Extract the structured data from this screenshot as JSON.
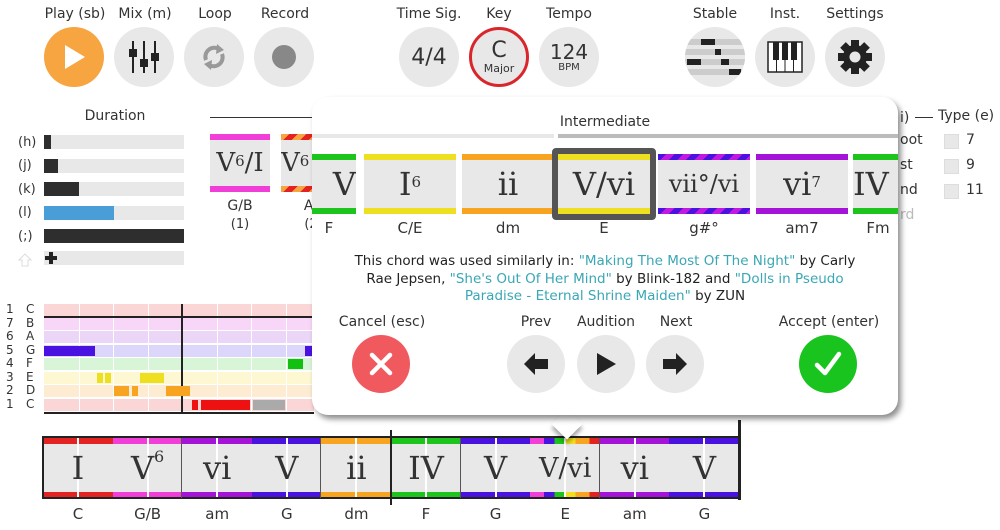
{
  "toolbar": {
    "play": {
      "label": "Play (sb)",
      "icon": "play-icon"
    },
    "mix": {
      "label": "Mix (m)",
      "icon": "mixer-sliders-icon"
    },
    "loop": {
      "label": "Loop",
      "icon": "loop-arrows-icon"
    },
    "record": {
      "label": "Record",
      "icon": "record-dot-icon"
    },
    "time_sig": {
      "label": "Time Sig.",
      "value": "4/4"
    },
    "key": {
      "label": "Key",
      "value": "C",
      "mode": "Major"
    },
    "tempo": {
      "label": "Tempo",
      "value": "124",
      "unit": "BPM"
    },
    "stable": {
      "label": "Stable",
      "icon": "piano-roll-icon"
    },
    "inst": {
      "label": "Inst.",
      "icon": "piano-keys-icon"
    },
    "settings": {
      "label": "Settings",
      "icon": "gear-icon"
    },
    "accent_color": "#f7a541",
    "key_ring_color": "#d9262b"
  },
  "duration": {
    "title": "Duration",
    "rows": [
      {
        "key": "(h)",
        "fill": 0.05,
        "selected": false
      },
      {
        "key": "(j)",
        "fill": 0.1,
        "selected": false
      },
      {
        "key": "(k)",
        "fill": 0.25,
        "selected": false
      },
      {
        "key": "(l)",
        "fill": 0.5,
        "selected": true
      },
      {
        "key": "(;)",
        "fill": 1.0,
        "selected": false
      }
    ],
    "add_row_icon": "plus-icon",
    "shift_icon": "shift-arrow-icon",
    "selected_color": "#4a9ed8"
  },
  "background_suggestions": [
    {
      "numeral": "V",
      "sup": "6",
      "suffix": "/I",
      "name": "G/B",
      "hotkey": "(1)"
    },
    {
      "numeral": "V",
      "sup": "6",
      "suffix": "",
      "name": "A/",
      "hotkey": "(2"
    }
  ],
  "type_panel": {
    "title": "Type (e)",
    "partial_left_label": "i)",
    "options": [
      "7",
      "9",
      "11"
    ],
    "partial_inversion_labels": [
      "oot",
      "st",
      "nd",
      "rd"
    ]
  },
  "piano_roll": {
    "rows": [
      {
        "degree": "1",
        "note": "C"
      },
      {
        "degree": "7",
        "note": "B"
      },
      {
        "degree": "6",
        "note": "A"
      },
      {
        "degree": "5",
        "note": "G"
      },
      {
        "degree": "4",
        "note": "F"
      },
      {
        "degree": "3",
        "note": "E"
      },
      {
        "degree": "2",
        "note": "D"
      },
      {
        "degree": "1",
        "note": "C"
      }
    ]
  },
  "popup": {
    "section_title": "Intermediate",
    "chords": [
      {
        "numeral": "V",
        "sup": "",
        "name": "F",
        "partial": true
      },
      {
        "numeral": "I",
        "sup": "6",
        "name": "C/E"
      },
      {
        "numeral": "ii",
        "sup": "",
        "name": "dm"
      },
      {
        "numeral": "V/vi",
        "sup": "",
        "name": "E",
        "selected": true
      },
      {
        "numeral": "vii°/vi",
        "sup": "",
        "name": "g#°"
      },
      {
        "numeral": "vi",
        "sup": "7",
        "name": "am7"
      },
      {
        "numeral": "IV",
        "sup": "",
        "name": "Fm",
        "partial": true
      }
    ],
    "usage": {
      "prefix": "This chord was used similarly in: ",
      "songs": [
        {
          "title": "\"Making The Most Of The Night\"",
          "artist": " by Carly Rae Jepsen, "
        },
        {
          "title": "\"She's Out Of Her Mind\"",
          "artist": " by Blink-182 and "
        },
        {
          "title": "\"Dolls in Pseudo Paradise - Eternal Shrine Maiden\"",
          "artist": " by ZUN"
        }
      ]
    },
    "cancel": {
      "label": "Cancel (esc)",
      "icon": "x-icon",
      "color": "#f05a5f"
    },
    "prev": {
      "label": "Prev",
      "icon": "arrow-left-icon"
    },
    "audition": {
      "label": "Audition",
      "icon": "play-icon"
    },
    "next": {
      "label": "Next",
      "icon": "arrow-right-icon"
    },
    "accept": {
      "label": "Accept (enter)",
      "icon": "checkmark-icon",
      "color": "#1ac41f"
    },
    "link_color": "#3aa7b5"
  },
  "timeline": {
    "chords": [
      {
        "numeral": "I",
        "sup": "",
        "name": "C"
      },
      {
        "numeral": "V",
        "sup": "6",
        "name": "G/B"
      },
      {
        "numeral": "vi",
        "sup": "",
        "name": "am"
      },
      {
        "numeral": "V",
        "sup": "",
        "name": "G"
      },
      {
        "numeral": "ii",
        "sup": "",
        "name": "dm"
      },
      {
        "numeral": "IV",
        "sup": "",
        "name": "F"
      },
      {
        "numeral": "V",
        "sup": "",
        "name": "G"
      },
      {
        "numeral": "V/vi",
        "sup": "",
        "name": "E",
        "selected": true
      },
      {
        "numeral": "vi",
        "sup": "",
        "name": "am"
      },
      {
        "numeral": "V",
        "sup": "",
        "name": "G"
      }
    ]
  }
}
